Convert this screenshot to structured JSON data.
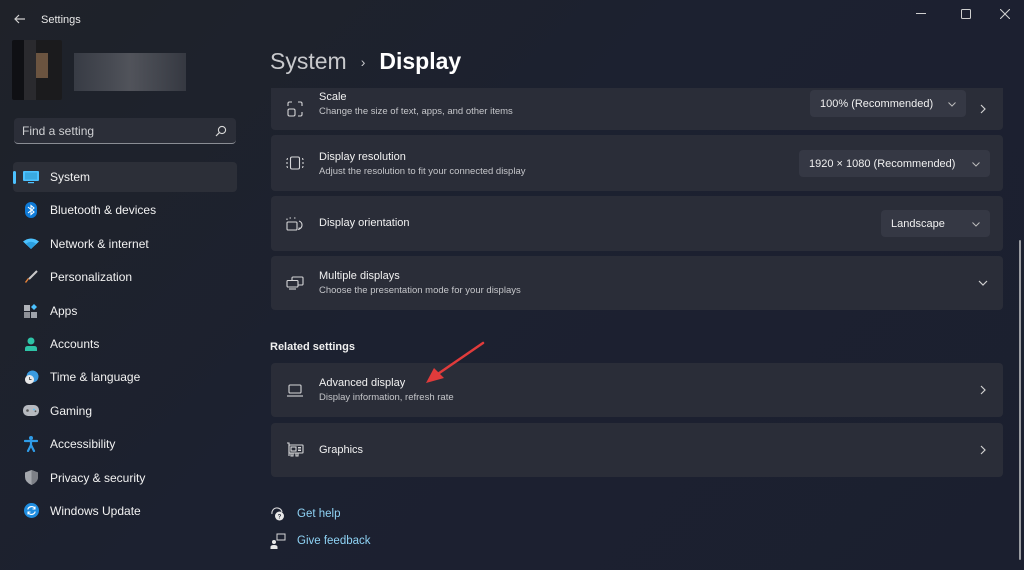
{
  "window": {
    "title": "Settings",
    "controls": {
      "minimize": "minimize",
      "maximize": "maximize",
      "close": "close"
    }
  },
  "search": {
    "placeholder": "Find a setting",
    "value": ""
  },
  "sidebar": {
    "items": [
      {
        "label": "System",
        "icon": "monitor-icon",
        "active": true,
        "color": "#4cc2ff"
      },
      {
        "label": "Bluetooth & devices",
        "icon": "bluetooth-icon",
        "color": "#0f7bd8"
      },
      {
        "label": "Network & internet",
        "icon": "wifi-icon",
        "color": "#4cc2ff"
      },
      {
        "label": "Personalization",
        "icon": "paintbrush-icon",
        "color": "#e8843a"
      },
      {
        "label": "Apps",
        "icon": "apps-icon",
        "color": "#9fa3ab"
      },
      {
        "label": "Accounts",
        "icon": "person-icon",
        "color": "#2ec4a7"
      },
      {
        "label": "Time & language",
        "icon": "clock-globe-icon",
        "color": "#3a9be0"
      },
      {
        "label": "Gaming",
        "icon": "gamepad-icon",
        "color": "#b7bac0"
      },
      {
        "label": "Accessibility",
        "icon": "accessibility-icon",
        "color": "#2f9ce8"
      },
      {
        "label": "Privacy & security",
        "icon": "shield-icon",
        "color": "#a4a7ad"
      },
      {
        "label": "Windows Update",
        "icon": "update-icon",
        "color": "#1f8de0"
      }
    ]
  },
  "breadcrumb": {
    "parent": "System",
    "separator": "›",
    "current": "Display"
  },
  "settings": [
    {
      "title": "Scale",
      "subtitle": "Change the size of text, apps, and other items",
      "icon": "scale-icon",
      "control": "dropdown",
      "value": "100% (Recommended)",
      "has_chevron": true
    },
    {
      "title": "Display resolution",
      "subtitle": "Adjust the resolution to fit your connected display",
      "icon": "resolution-icon",
      "control": "dropdown",
      "value": "1920 × 1080 (Recommended)"
    },
    {
      "title": "Display orientation",
      "subtitle": "",
      "icon": "orientation-icon",
      "control": "dropdown",
      "value": "Landscape"
    },
    {
      "title": "Multiple displays",
      "subtitle": "Choose the presentation mode for your displays",
      "icon": "multiple-displays-icon",
      "control": "expand"
    }
  ],
  "related": {
    "title": "Related settings",
    "items": [
      {
        "title": "Advanced display",
        "subtitle": "Display information, refresh rate",
        "icon": "laptop-icon"
      },
      {
        "title": "Graphics",
        "subtitle": "",
        "icon": "graphics-card-icon"
      }
    ]
  },
  "help": [
    {
      "label": "Get help",
      "icon": "help-icon"
    },
    {
      "label": "Give feedback",
      "icon": "feedback-icon"
    }
  ],
  "annotation": {
    "type": "arrow",
    "color": "#e03b3b",
    "target": "Advanced display"
  },
  "accent": "#4cc2ff"
}
